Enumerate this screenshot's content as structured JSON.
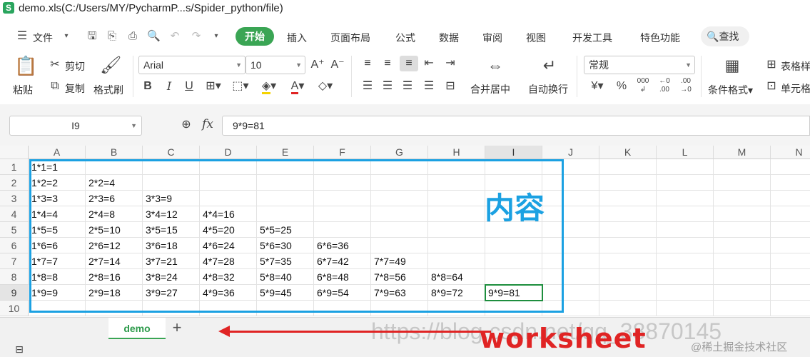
{
  "window": {
    "app_icon": "S",
    "title": "demo.xls(C:/Users/MY/PycharmP...s/Spider_python/file)"
  },
  "menu": {
    "file_label": "文件",
    "tabs": [
      "开始",
      "插入",
      "页面布局",
      "公式",
      "数据",
      "审阅",
      "视图",
      "开发工具",
      "特色功能"
    ],
    "search_label": "查找"
  },
  "ribbon": {
    "paste": "粘贴",
    "cut": "剪切",
    "copy": "复制",
    "format_painter": "格式刷",
    "font_name": "Arial",
    "font_size": "10",
    "bold": "B",
    "italic": "I",
    "underline": "U",
    "merge_center": "合并居中",
    "wrap_text": "自动换行",
    "number_format": "常规",
    "currency": "¥",
    "percent": "%",
    "conditional_format": "条件格式",
    "table_style": "表格样",
    "cell_style": "单元格"
  },
  "formula_bar": {
    "name_box": "I9",
    "fx_label": "fx",
    "formula": "9*9=81"
  },
  "grid": {
    "columns": [
      "A",
      "B",
      "C",
      "D",
      "E",
      "F",
      "G",
      "H",
      "I",
      "J",
      "K",
      "L",
      "M",
      "N"
    ],
    "rows": [
      "1",
      "2",
      "3",
      "4",
      "5",
      "6",
      "7",
      "8",
      "9",
      "10"
    ],
    "cells": [
      [
        "1*1=1"
      ],
      [
        "1*2=2",
        "2*2=4"
      ],
      [
        "1*3=3",
        "2*3=6",
        "3*3=9"
      ],
      [
        "1*4=4",
        "2*4=8",
        "3*4=12",
        "4*4=16"
      ],
      [
        "1*5=5",
        "2*5=10",
        "3*5=15",
        "4*5=20",
        "5*5=25"
      ],
      [
        "1*6=6",
        "2*6=12",
        "3*6=18",
        "4*6=24",
        "5*6=30",
        "6*6=36"
      ],
      [
        "1*7=7",
        "2*7=14",
        "3*7=21",
        "4*7=28",
        "5*7=35",
        "6*7=42",
        "7*7=49"
      ],
      [
        "1*8=8",
        "2*8=16",
        "3*8=24",
        "4*8=32",
        "5*8=40",
        "6*8=48",
        "7*8=56",
        "8*8=64"
      ],
      [
        "1*9=9",
        "2*9=18",
        "3*9=27",
        "4*9=36",
        "5*9=45",
        "6*9=54",
        "7*9=63",
        "8*9=72",
        "9*9=81"
      ],
      []
    ],
    "selected_cell": "I9"
  },
  "annotations": {
    "content_label": "内容",
    "worksheet_label": "worksheet",
    "box_color": "#1ba1e2",
    "arrow_color": "#e02424"
  },
  "sheets": {
    "tabs": [
      "demo"
    ],
    "active": "demo"
  },
  "watermark": {
    "url": "https://blog.csdn.net/qq_38870145",
    "site": "@稀土掘金技术社区"
  }
}
